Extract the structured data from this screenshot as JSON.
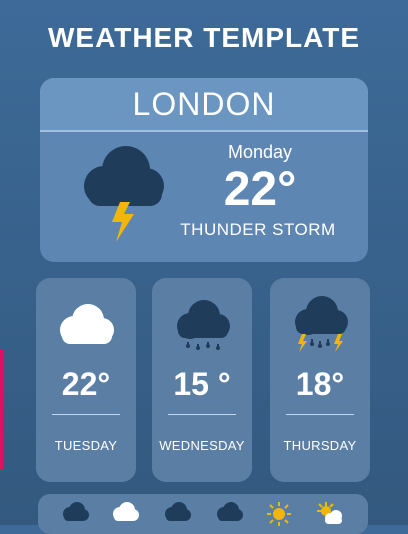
{
  "header": {
    "title": "WEATHER TEMPLATE"
  },
  "current": {
    "city": "LONDON",
    "day": "Monday",
    "temperature": "22°",
    "condition": "THUNDER STORM",
    "icon": "thunderstorm-icon"
  },
  "forecast": [
    {
      "temperature": "22°",
      "day": "TUESDAY",
      "icon": "cloud-icon"
    },
    {
      "temperature": "15 °",
      "day": "WEDNESDAY",
      "icon": "rain-cloud-icon"
    },
    {
      "temperature": "18°",
      "day": "THURSDAY",
      "icon": "storm-rain-cloud-icon"
    }
  ],
  "bottom_icons": [
    "dark-cloud-icon",
    "white-cloud-icon",
    "dark-cloud-icon",
    "rain-cloud-icon",
    "sun-icon",
    "sun-cloud-icon"
  ],
  "colors": {
    "background": "#3d6a98",
    "card": "#5e86b2",
    "dark_cloud": "#1f3c5a",
    "bolt": "#f2b60a"
  }
}
